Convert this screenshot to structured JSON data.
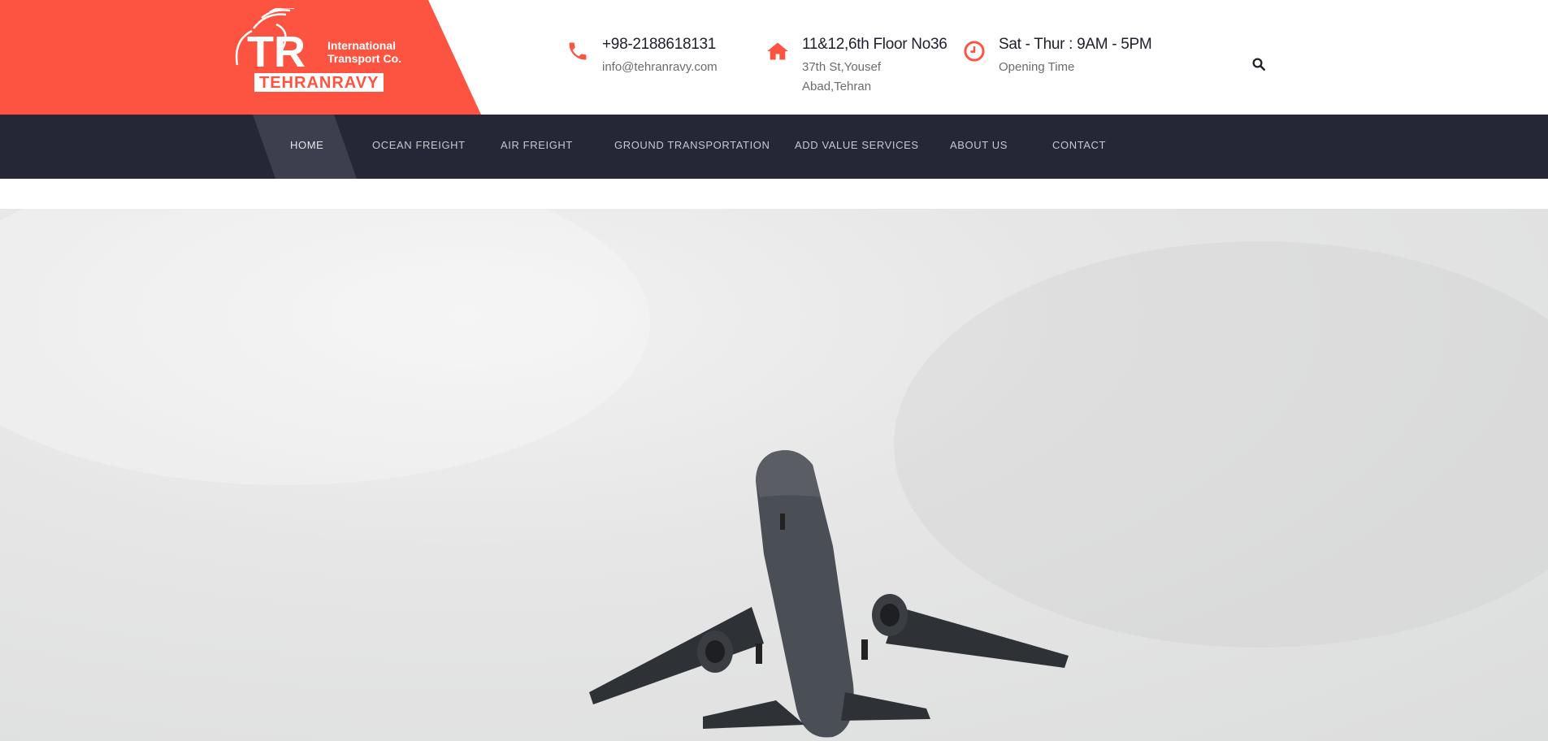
{
  "header": {
    "logo": {
      "brand": "TEHRANRAVY",
      "tagline_line1": "International",
      "tagline_line2": "Transport Co.",
      "monogram": "TR"
    },
    "contacts": [
      {
        "icon": "phone-icon",
        "title": "+98-2188618131",
        "sub_line1": "info@tehranravy.com",
        "sub_line2": ""
      },
      {
        "icon": "home-icon",
        "title": "11&12,6th Floor No36",
        "sub_line1": "37th St,Yousef",
        "sub_line2": "Abad,Tehran"
      },
      {
        "icon": "clock-icon",
        "title": "Sat - Thur : 9AM - 5PM",
        "sub_line1": "Opening Time",
        "sub_line2": ""
      }
    ],
    "search_icon": "search-icon"
  },
  "nav": {
    "active_index": 0,
    "items": [
      {
        "label": "HOME"
      },
      {
        "label": "OCEAN FREIGHT"
      },
      {
        "label": "AIR FREIGHT"
      },
      {
        "label": "GROUND TRANSPORTATION"
      },
      {
        "label": "ADD VALUE SERVICES"
      },
      {
        "label": "ABOUT US"
      },
      {
        "label": "CONTACT"
      }
    ]
  },
  "hero": {
    "image": "airplane-taking-off-photo"
  },
  "colors": {
    "brand": "#fd5442",
    "nav_bg": "#252737",
    "nav_active": "#3d3f4e",
    "text_dark": "#1e1e2c",
    "text_muted": "#6b6b6b"
  }
}
